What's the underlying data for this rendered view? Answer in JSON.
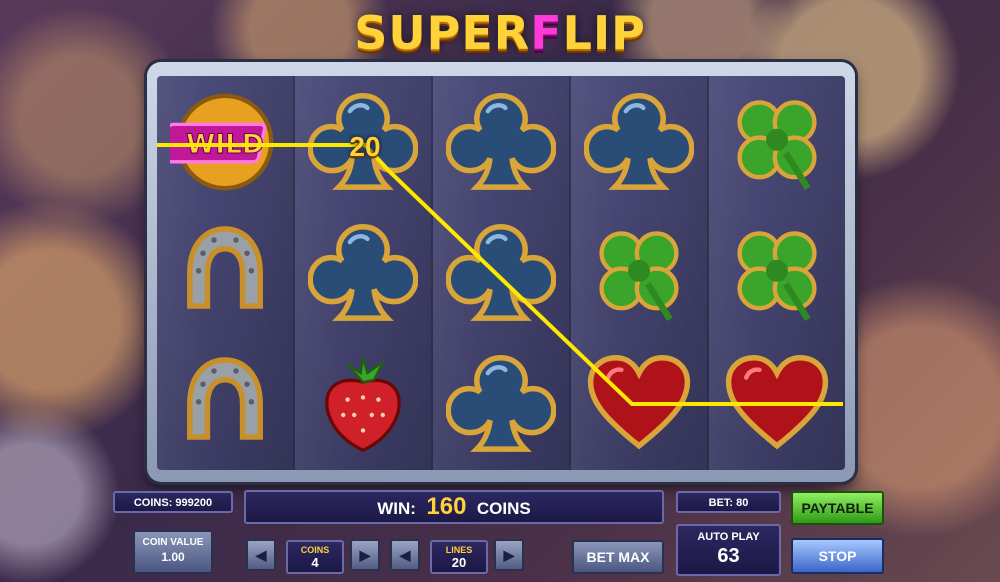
{
  "game": {
    "title_main": "SUPER",
    "title_f": "F",
    "title_end": "LIP"
  },
  "reels": [
    [
      "wild",
      "horseshoe",
      "horseshoe"
    ],
    [
      "club",
      "club",
      "strawberry"
    ],
    [
      "club",
      "club",
      "club"
    ],
    [
      "club",
      "clover",
      "heart"
    ],
    [
      "clover",
      "clover",
      "heart"
    ]
  ],
  "win_badge": "20",
  "panel": {
    "coins_label": "COINS: 999200",
    "win_label": "WIN:",
    "win_value": "160",
    "win_unit": "COINS",
    "bet_label": "BET: 80",
    "paytable": "PAYTABLE",
    "coin_value_label": "COIN VALUE",
    "coin_value": "1.00",
    "coins_sel_label": "COINS",
    "coins_sel_value": "4",
    "lines_label": "LINES",
    "lines_value": "20",
    "bet_max": "BET MAX",
    "auto_play_label": "AUTO PLAY",
    "auto_play_value": "63",
    "stop": "STOP",
    "minus": "◀",
    "plus": "▶"
  },
  "colors": {
    "payline": "#ffe800",
    "gold": "#ffd23a",
    "paytable_green": "#4bd62a"
  }
}
